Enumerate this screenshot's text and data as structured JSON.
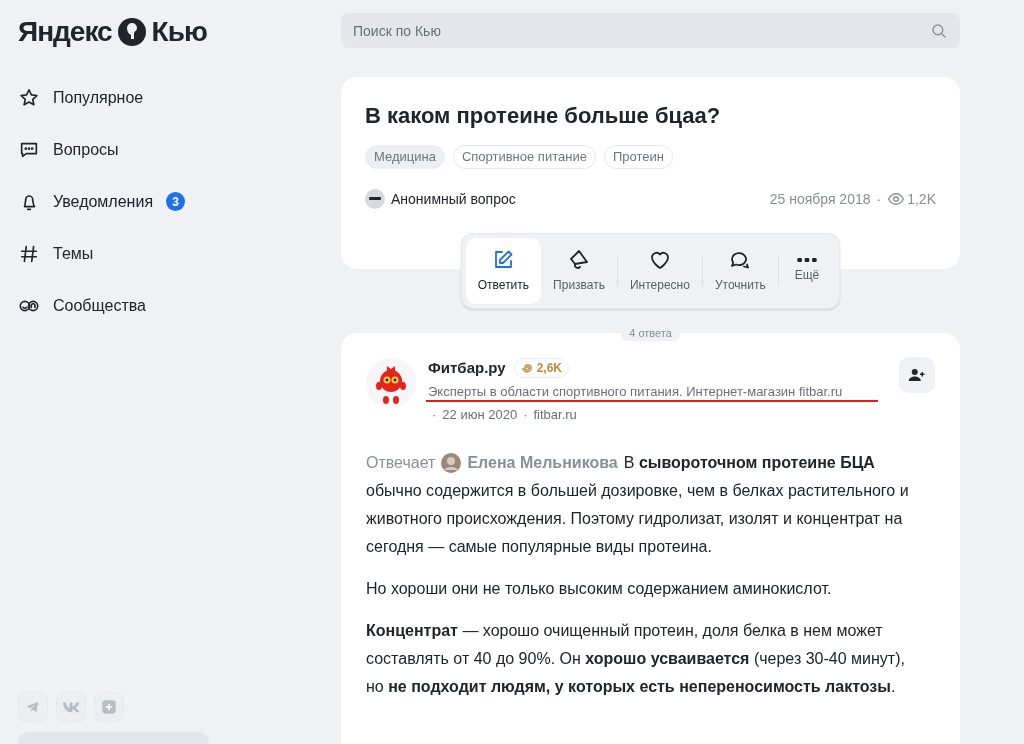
{
  "logo": {
    "brand": "Яндекс",
    "product": "Кью"
  },
  "nav": [
    {
      "label": "Популярное",
      "kind": "star"
    },
    {
      "label": "Вопросы",
      "kind": "chat"
    },
    {
      "label": "Уведомления",
      "kind": "bell",
      "badge": "3"
    },
    {
      "label": "Темы",
      "kind": "hash"
    },
    {
      "label": "Сообщества",
      "kind": "community"
    }
  ],
  "social": [
    {
      "kind": "telegram"
    },
    {
      "kind": "vk"
    },
    {
      "kind": "plus"
    }
  ],
  "search": {
    "placeholder": "Поиск по Кью"
  },
  "question": {
    "title": "В каком протеине больше бцаа?",
    "tags": [
      {
        "label": "Медицина",
        "selected": true
      },
      {
        "label": "Спортивное питание",
        "selected": false
      },
      {
        "label": "Протеин",
        "selected": false
      }
    ],
    "author": "Анонимный вопрос",
    "meta": [
      "25 ноября 2018",
      "·"
    ],
    "views": "1,2K"
  },
  "actions": [
    {
      "label": "Ответить",
      "kind": "edit",
      "selected": true
    },
    {
      "label": "Призвать",
      "kind": "megaphone",
      "selected": false
    },
    {
      "label": "Интересно",
      "kind": "heart",
      "selected": false
    },
    {
      "label": "Уточнить",
      "kind": "bubbles",
      "selected": false
    },
    {
      "label": "Ещё",
      "kind": "more",
      "selected": false
    }
  ],
  "answers_count": "4 ответа",
  "answer": {
    "author": "Фитбар.ру",
    "rating": "2,6K",
    "description": "Эксперты в области спортивного питания. Интернет-магазин fitbar.ru",
    "description_underlined": true,
    "meta": [
      "·",
      "22 июн 2020",
      "·",
      "fitbar.ru"
    ],
    "byline_label": "Отвечает",
    "byline_name": "Елена Мельникова",
    "lead_start": "В **сывороточном протеине БЦА**",
    "lead": "обычно содержится в большей дозировке, чем в белках растительного и животного происхождения. Поэтому гидролизат, изолят и концентрат на сегодня — самые популярные виды протеина.",
    "paragraphs": [
      "Но хороши они не только высоким содержанием аминокислот.",
      "**Концентрат** — хорошо очищенный протеин, доля белка в нем может составлять от 40 до 90%. Он **хорошо усваивается** (через 30-40 минут), но **не подходит людям, у которых есть непереносимость лактозы**."
    ]
  }
}
